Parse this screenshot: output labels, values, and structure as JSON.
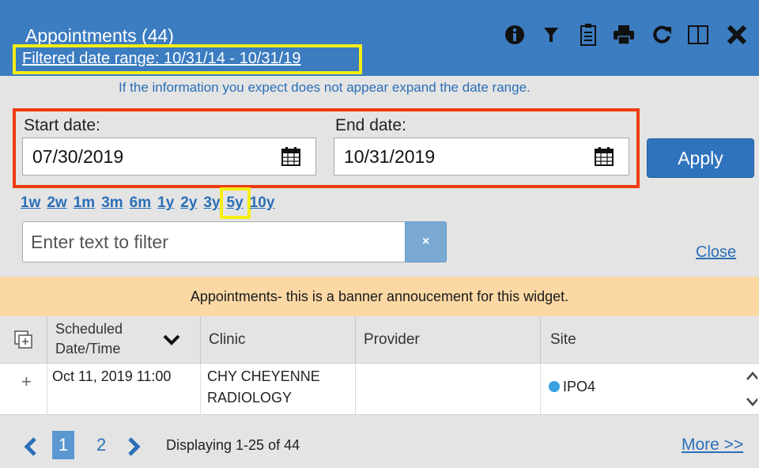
{
  "header": {
    "title": "Appointments (44)",
    "filtered_range": "Filtered date range: 10/31/14 - 10/31/19",
    "toolbar": [
      {
        "icon": "info-icon"
      },
      {
        "icon": "filter-icon"
      },
      {
        "icon": "clipboard-icon"
      },
      {
        "icon": "print-icon"
      },
      {
        "icon": "refresh-icon"
      },
      {
        "icon": "maximize-icon"
      },
      {
        "icon": "close-icon"
      }
    ]
  },
  "info_message": "If the information you expect does not appear expand the date range.",
  "date_filter": {
    "start_label": "Start date:",
    "start_value": "07/30/2019",
    "end_label": "End date:",
    "end_value": "10/31/2019",
    "apply_label": "Apply"
  },
  "range_links": [
    "1w",
    "2w",
    "1m",
    "3m",
    "6m",
    "1y",
    "2y",
    "3y",
    "5y",
    "10y"
  ],
  "selected_range": "5y",
  "text_filter": {
    "placeholder": "Enter text to filter",
    "clear_label": "×",
    "close_label": "Close"
  },
  "banner": "Appointments- this is a banner annoucement for this widget.",
  "table": {
    "columns": [
      {
        "label_line1": "Scheduled",
        "label_line2": "Date/Time",
        "sort": "descending"
      },
      {
        "label": "Clinic"
      },
      {
        "label": "Provider"
      },
      {
        "label": "Site"
      }
    ],
    "rows": [
      {
        "expand": "+",
        "date_time": "Oct 11, 2019 11:00",
        "clinic_line1": "CHY CHEYENNE",
        "clinic_line2": "RADIOLOGY",
        "provider": "",
        "site": "IPO4",
        "site_status_color": "#3aa1e3"
      }
    ]
  },
  "pagination": {
    "pages": [
      "1",
      "2"
    ],
    "current_page": "1",
    "status": "Displaying 1-25 of 44",
    "more_label": "More >>"
  },
  "colors": {
    "header_bg": "#3c7cc0",
    "link": "#2a6fb7",
    "apply_button": "#2f73bd",
    "banner_bg": "#fbd8a4",
    "highlight_yellow": "#f5ee14",
    "highlight_red": "#ee3b10"
  }
}
